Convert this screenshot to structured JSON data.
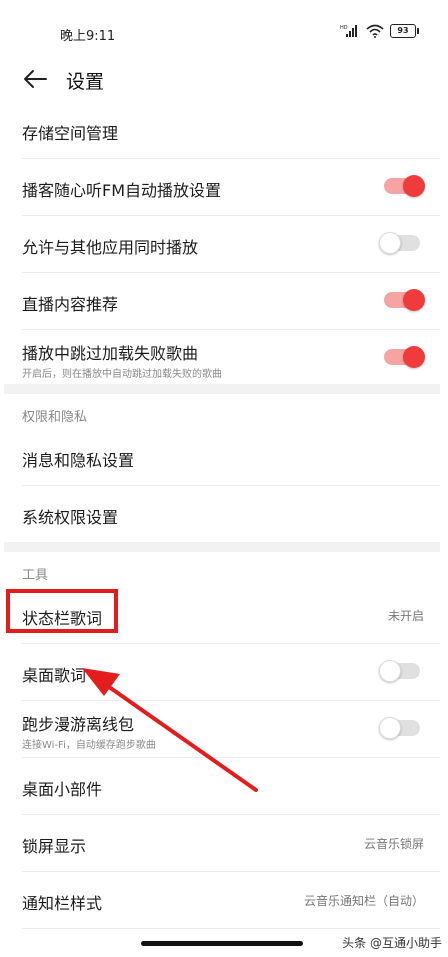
{
  "status_bar": {
    "time": "晚上9:11",
    "network": "HD",
    "battery": "93"
  },
  "header": {
    "title": "设置"
  },
  "rows_top": [
    {
      "label": "存储空间管理"
    },
    {
      "label": "播客随心听FM自动播放设置",
      "toggle": true
    },
    {
      "label": "允许与其他应用同时播放",
      "toggle": false
    },
    {
      "label": "直播内容推荐",
      "toggle": true
    },
    {
      "label": "播放中跳过加载失败歌曲",
      "sub": "开启后，则在播放中自动跳过加载失败的歌曲",
      "toggle": true
    }
  ],
  "section_privacy": {
    "title": "权限和隐私",
    "rows": [
      {
        "label": "消息和隐私设置"
      },
      {
        "label": "系统权限设置"
      }
    ]
  },
  "section_tools": {
    "title": "工具",
    "rows": [
      {
        "label": "状态栏歌词",
        "value": "未开启"
      },
      {
        "label": "桌面歌词",
        "toggle": false
      },
      {
        "label": "跑步漫游离线包",
        "sub": "连接Wi-Fi，自动缓存跑步歌曲",
        "toggle": false
      },
      {
        "label": "桌面小部件"
      },
      {
        "label": "锁屏显示",
        "value": "云音乐锁屏"
      },
      {
        "label": "通知栏样式",
        "value": "云音乐通知栏（自动）"
      }
    ]
  },
  "watermark": "头条 @互通小助手",
  "colors": {
    "accent": "#ef3b3b",
    "toggle_track_on": "#f5a3a3",
    "toggle_track_off": "#e0e0e0",
    "annotation": "#e31c1c"
  }
}
